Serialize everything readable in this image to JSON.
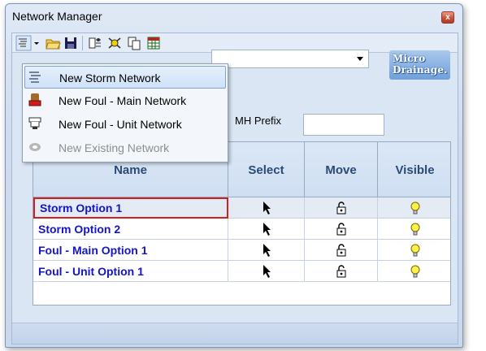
{
  "window": {
    "title": "Network Manager",
    "close_label": "x"
  },
  "toolbar": {
    "buttons": [
      {
        "name": "new-network-dropdown-icon"
      },
      {
        "name": "open-folder-icon"
      },
      {
        "name": "save-disk-icon"
      },
      {
        "name": "network-properties-icon"
      },
      {
        "name": "delete-network-icon"
      },
      {
        "name": "copy-icon"
      },
      {
        "name": "table-grid-icon"
      }
    ]
  },
  "menu": {
    "items": [
      {
        "label": "New Storm Network",
        "icon": "storm-network-icon",
        "state": "hover"
      },
      {
        "label": "New Foul - Main Network",
        "icon": "foul-main-network-icon",
        "state": "normal"
      },
      {
        "label": "New Foul - Unit Network",
        "icon": "foul-unit-network-icon",
        "state": "normal"
      },
      {
        "label": "New Existing Network",
        "icon": "existing-network-icon",
        "state": "disabled"
      }
    ]
  },
  "form": {
    "mh_prefix_label": "MH Prefix",
    "mh_prefix_value": "",
    "network_combo_value": ""
  },
  "logo": {
    "line1": "Micro",
    "line2": "Drainage."
  },
  "grid": {
    "columns": [
      "Name",
      "Select",
      "Move",
      "Visible"
    ],
    "rows": [
      {
        "name": "Storm Option 1",
        "selected": true
      },
      {
        "name": "Storm Option 2",
        "selected": false
      },
      {
        "name": "Foul - Main Option 1",
        "selected": false
      },
      {
        "name": "Foul - Unit Option 1",
        "selected": false
      }
    ],
    "icons": {
      "select": "arrow-cursor-icon",
      "move": "padlock-icon",
      "visible": "lightbulb-icon"
    }
  },
  "colors": {
    "name_text": "#1414c8",
    "selection_border": "#d02020",
    "header_text": "#2a4a78"
  }
}
